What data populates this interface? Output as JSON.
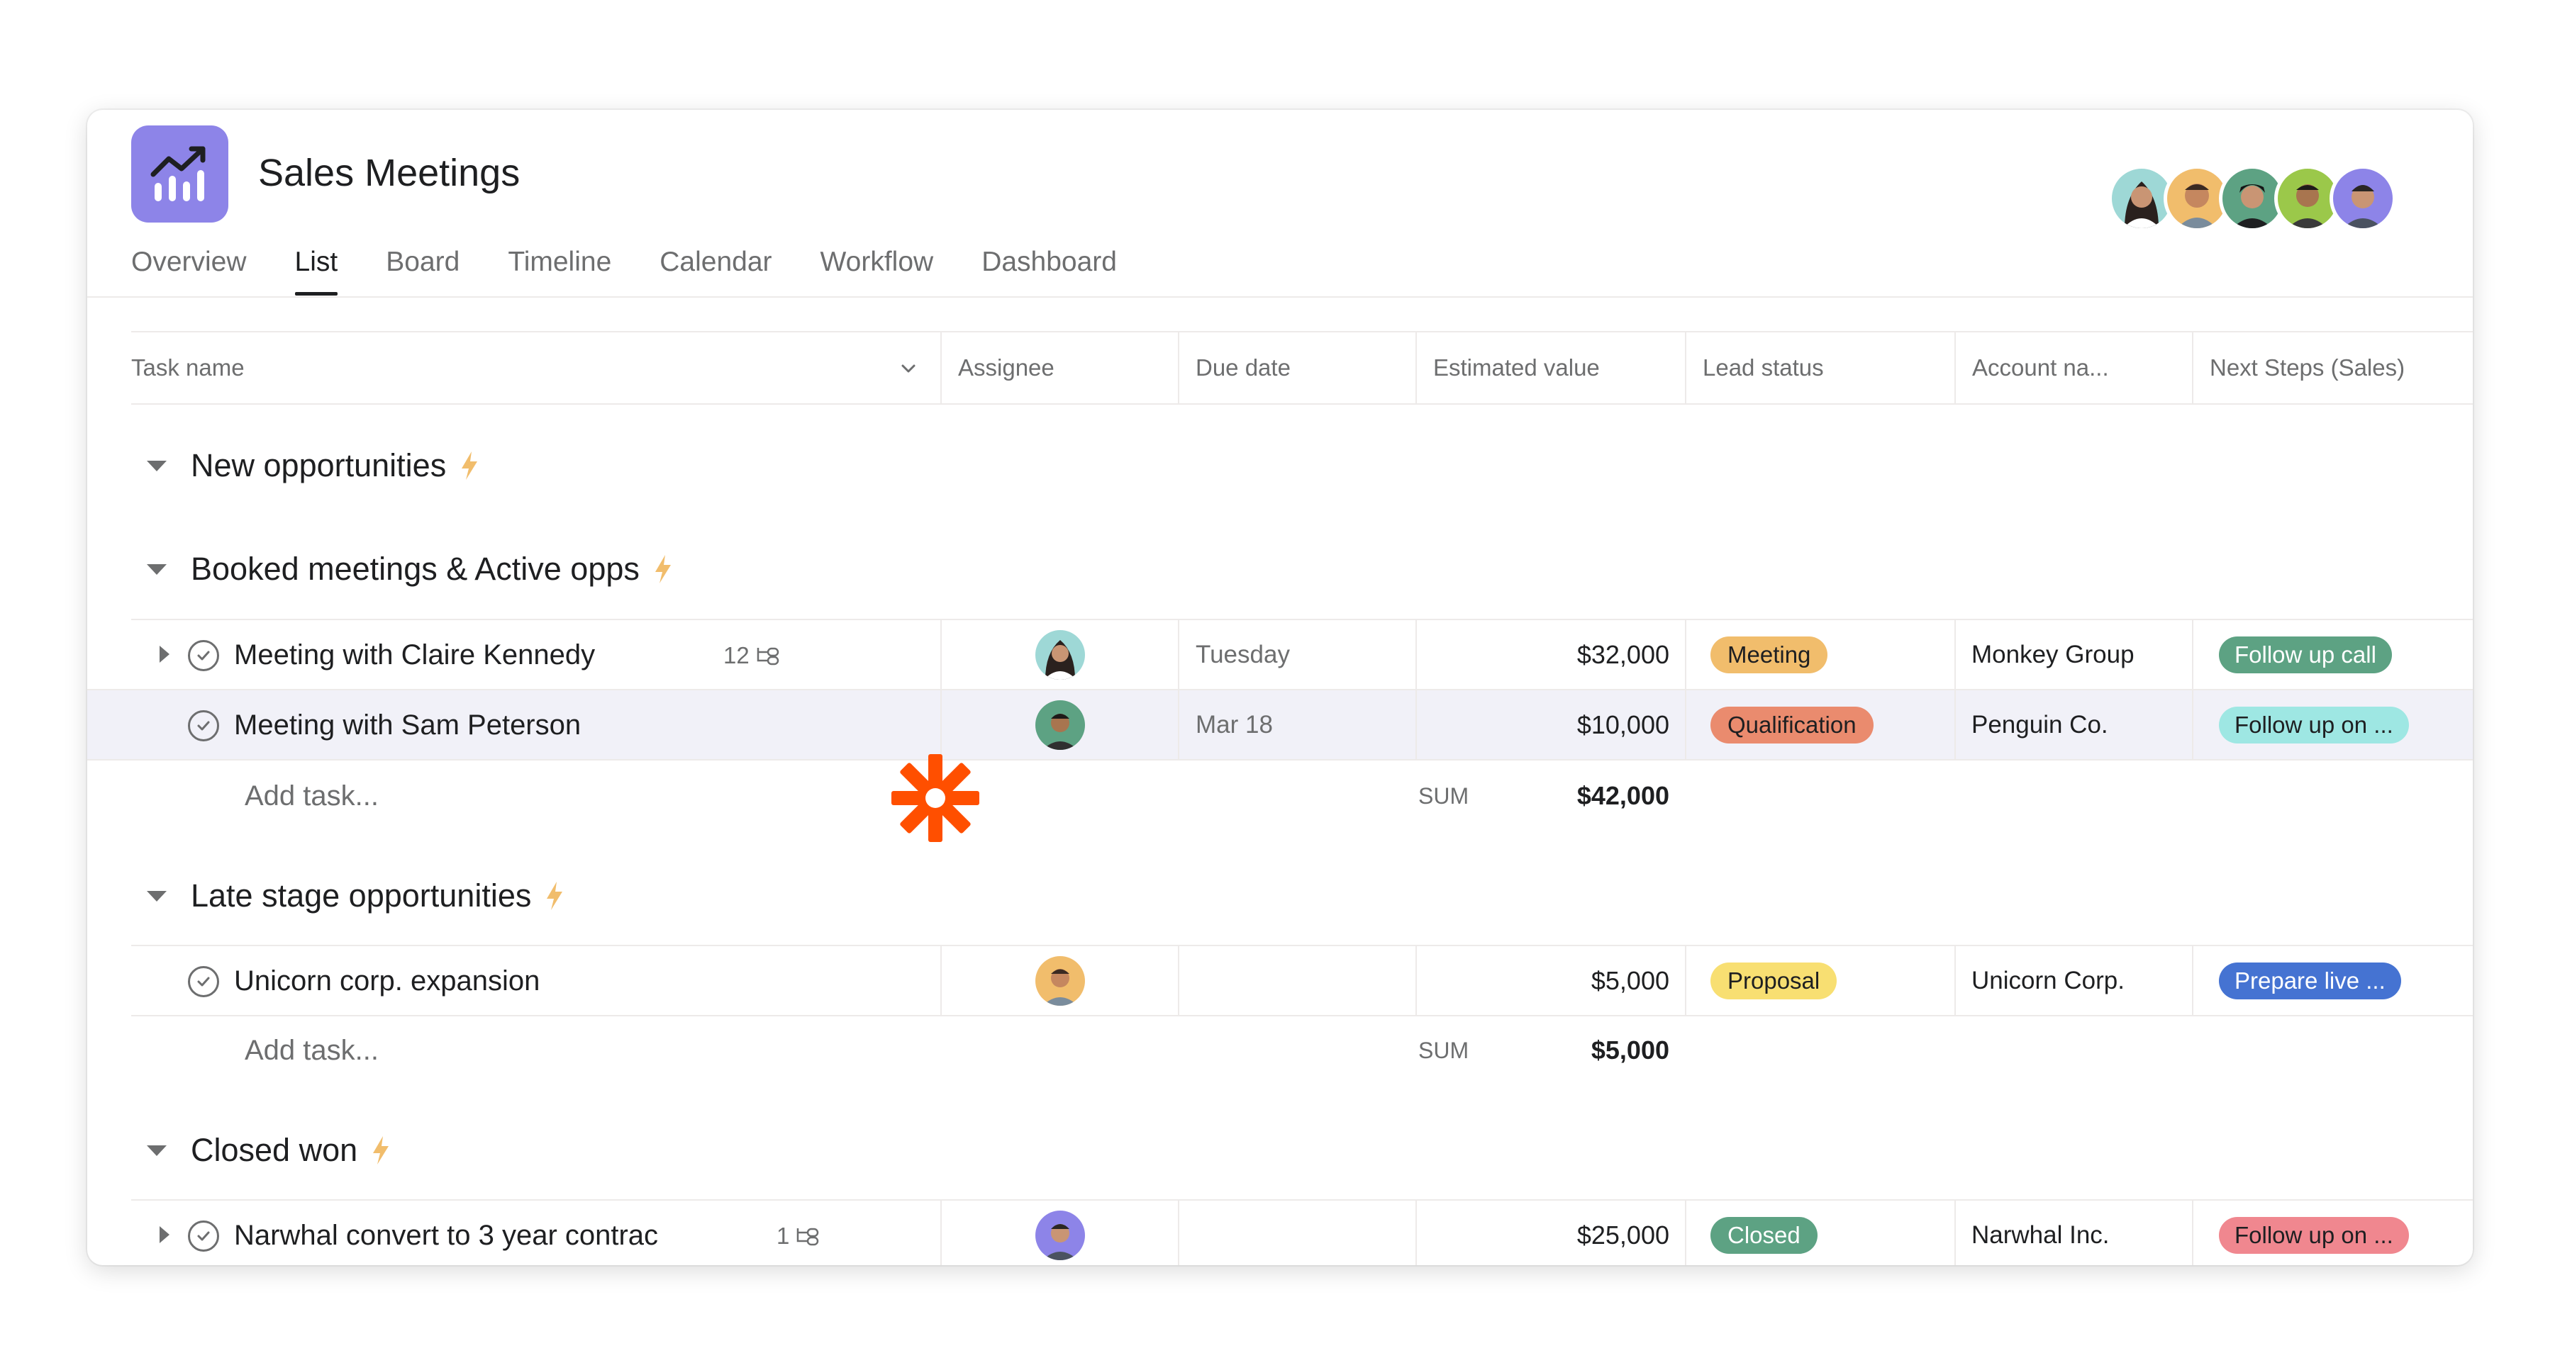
{
  "project": {
    "title": "Sales Meetings",
    "icon": "chart-trend-icon",
    "icon_color": "#8d84e8"
  },
  "tabs": [
    {
      "label": "Overview",
      "active": false
    },
    {
      "label": "List",
      "active": true
    },
    {
      "label": "Board",
      "active": false
    },
    {
      "label": "Timeline",
      "active": false
    },
    {
      "label": "Calendar",
      "active": false
    },
    {
      "label": "Workflow",
      "active": false
    },
    {
      "label": "Dashboard",
      "active": false
    }
  ],
  "columns": [
    "Task name",
    "Assignee",
    "Due date",
    "Estimated value",
    "Lead status",
    "Account na...",
    "Next Steps (Sales)"
  ],
  "sections": [
    {
      "title": "New opportunities"
    },
    {
      "title": "Booked meetings & Active opps"
    },
    {
      "title": "Late stage opportunities"
    },
    {
      "title": "Closed won"
    }
  ],
  "tasks": [
    {
      "name": "Meeting with Claire Kennedy",
      "subtasks": "12",
      "due": "Tuesday",
      "value": "$32,000",
      "status": "Meeting",
      "account": "Monkey Group",
      "next": "Follow up call"
    },
    {
      "name": "Meeting with Sam Peterson",
      "subtasks": "",
      "due": "Mar 18",
      "value": "$10,000",
      "status": "Qualification",
      "account": "Penguin Co.",
      "next": "Follow up on ..."
    },
    {
      "name": "Unicorn corp. expansion",
      "subtasks": "",
      "due": "",
      "value": "$5,000",
      "status": "Proposal",
      "account": "Unicorn Corp.",
      "next": "Prepare live ..."
    },
    {
      "name": "Narwhal convert to 3 year contrac",
      "subtasks": "1",
      "due": "",
      "value": "$25,000",
      "status": "Closed",
      "account": "Narwhal Inc.",
      "next": "Follow up on ..."
    }
  ],
  "add_task_label": "Add task...",
  "sums": [
    {
      "label": "SUM",
      "value": "$42,000"
    },
    {
      "label": "SUM",
      "value": "$5,000"
    }
  ],
  "colors": {
    "meeting": "#f1bd6c",
    "qualification": "#f1845b",
    "proposal": "#f8df72",
    "closed": "#5da283",
    "follow_up_call": "#5da283",
    "follow_up_teal": "#9ee7e3",
    "prepare_live": "#4573d2",
    "follow_up_red": "#f26fb2",
    "bolt": "#f1bd6c",
    "zapier": "#ff4f00"
  }
}
